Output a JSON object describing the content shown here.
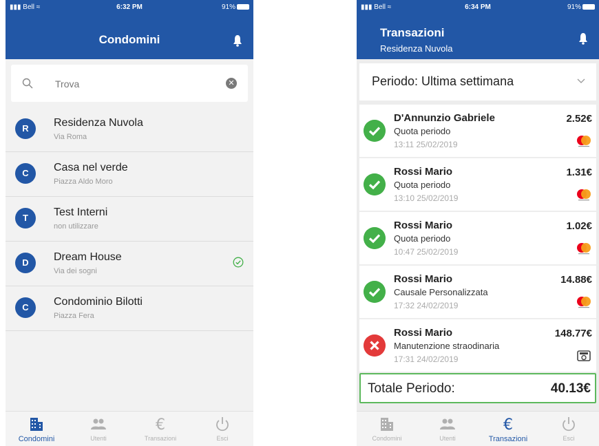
{
  "colors": {
    "brand": "#2257a6",
    "success": "#43b049",
    "error": "#e33a3a",
    "inactive": "#b0b0b0"
  },
  "left": {
    "status": {
      "carrier": "Bell",
      "time": "6:32 PM",
      "battery": "91%"
    },
    "header": {
      "title": "Condomini",
      "icon": "bell-icon"
    },
    "search": {
      "placeholder": "Trova",
      "icon": "search-icon",
      "clear_icon": "clear-icon"
    },
    "condos": [
      {
        "initial": "R",
        "name": "Residenza Nuvola",
        "address": "Via Roma",
        "selected": false
      },
      {
        "initial": "C",
        "name": "Casa nel verde",
        "address": "Piazza Aldo Moro",
        "selected": false
      },
      {
        "initial": "T",
        "name": "Test Interni",
        "address": "non utilizzare",
        "selected": false
      },
      {
        "initial": "D",
        "name": "Dream House",
        "address": "Via dei sogni",
        "selected": true
      },
      {
        "initial": "C",
        "name": "Condominio Bilotti",
        "address": "Piazza Fera",
        "selected": false
      }
    ],
    "tabs": [
      {
        "label": "Condomini",
        "icon": "building-icon",
        "active": true
      },
      {
        "label": "Utenti",
        "icon": "users-icon",
        "active": false
      },
      {
        "label": "Transazioni",
        "icon": "euro-icon",
        "active": false
      },
      {
        "label": "Esci",
        "icon": "power-icon",
        "active": false
      }
    ]
  },
  "right": {
    "status": {
      "carrier": "Bell",
      "time": "6:34 PM",
      "battery": "91%"
    },
    "header": {
      "title": "Transazioni",
      "subtitle": "Residenza Nuvola",
      "icon": "bell-icon"
    },
    "period": {
      "label": "Periodo: Ultima settimana"
    },
    "transactions": [
      {
        "name": "D'Annunzio Gabriele",
        "reason": "Quota periodo",
        "datetime": "13:11 25/02/2019",
        "amount": "2.52€",
        "status": "ok",
        "method": "mastercard-icon"
      },
      {
        "name": "Rossi Mario",
        "reason": "Quota periodo",
        "datetime": "13:10 25/02/2019",
        "amount": "1.31€",
        "status": "ok",
        "method": "mastercard-icon"
      },
      {
        "name": "Rossi Mario",
        "reason": "Quota periodo",
        "datetime": "10:47 25/02/2019",
        "amount": "1.02€",
        "status": "ok",
        "method": "mastercard-icon"
      },
      {
        "name": "Rossi Mario",
        "reason": "Causale Personalizzata",
        "datetime": "17:32 24/02/2019",
        "amount": "14.88€",
        "status": "ok",
        "method": "mastercard-icon"
      },
      {
        "name": "Rossi Mario",
        "reason": "Manutenzione straodinaria",
        "datetime": "17:31 24/02/2019",
        "amount": "148.77€",
        "status": "ko",
        "method": "cash-register-icon"
      }
    ],
    "total": {
      "label": "Totale Periodo:",
      "value": "40.13€"
    },
    "tabs": [
      {
        "label": "Condomini",
        "icon": "building-icon",
        "active": false
      },
      {
        "label": "Utenti",
        "icon": "users-icon",
        "active": false
      },
      {
        "label": "Transazioni",
        "icon": "euro-icon",
        "active": true
      },
      {
        "label": "Esci",
        "icon": "power-icon",
        "active": false
      }
    ]
  }
}
